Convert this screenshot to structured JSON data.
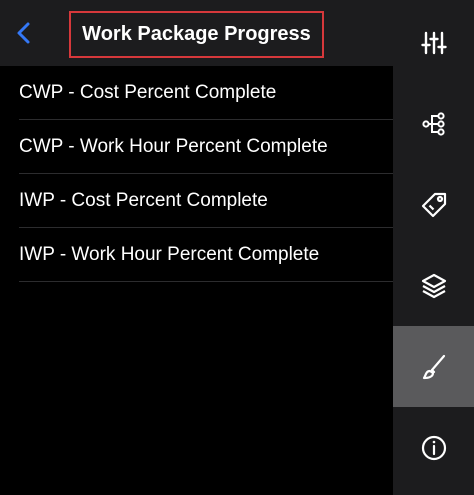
{
  "header": {
    "back_icon": "chevron-left-icon",
    "title": "Work Package Progress",
    "title_highlight_color": "#d6383b",
    "back_color": "#3478f6"
  },
  "list": {
    "items": [
      {
        "label": "CWP - Cost Percent Complete"
      },
      {
        "label": "CWP - Work Hour Percent Complete"
      },
      {
        "label": "IWP - Cost Percent Complete"
      },
      {
        "label": "IWP - Work Hour Percent Complete"
      }
    ]
  },
  "side_rail": {
    "buttons": [
      {
        "icon": "sliders-icon",
        "active": false
      },
      {
        "icon": "hierarchy-icon",
        "active": false
      },
      {
        "icon": "tag-icon",
        "active": false
      },
      {
        "icon": "layers-icon",
        "active": false
      },
      {
        "icon": "paintbrush-icon",
        "active": true
      },
      {
        "icon": "info-icon",
        "active": false
      }
    ]
  }
}
